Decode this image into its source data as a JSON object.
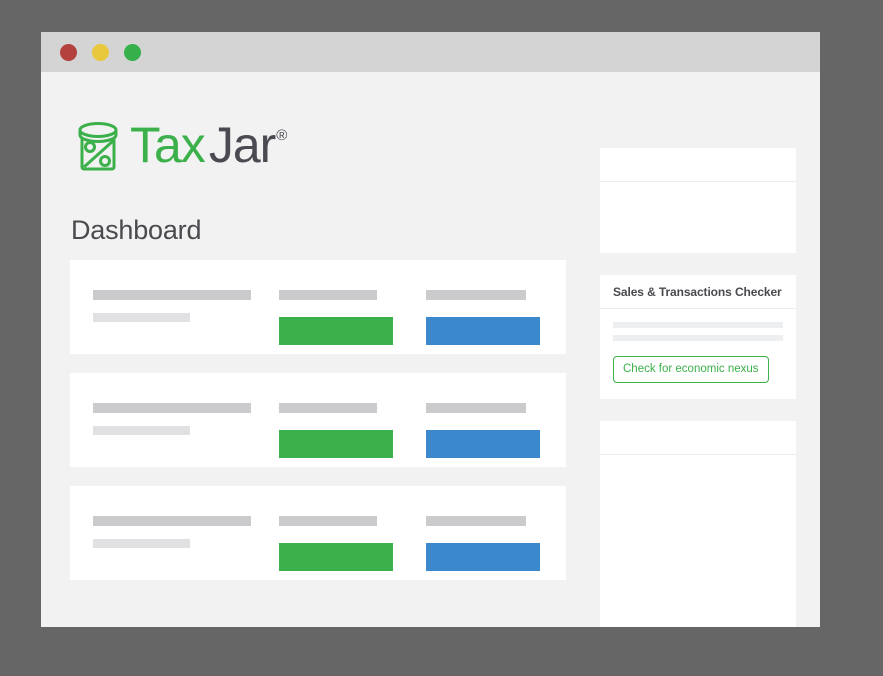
{
  "window": {
    "controls": [
      {
        "name": "close",
        "color": "#b3413e"
      },
      {
        "name": "minimize",
        "color": "#e8c93d"
      },
      {
        "name": "maximize",
        "color": "#36b04a"
      }
    ]
  },
  "brand": {
    "icon": "tax-jar-percent-icon",
    "word_primary": "Tax",
    "word_secondary": "Jar",
    "trademark": "®",
    "color_primary": "#3cb04a",
    "color_secondary": "#4a4a52"
  },
  "page": {
    "title": "Dashboard",
    "background": "#f2f2f2"
  },
  "main": {
    "cards": [
      {
        "title_bar": "",
        "subtitle_bar": "",
        "col_b_label_bar": "",
        "col_c_label_bar": "",
        "action_primary": "",
        "action_secondary": "",
        "action_primary_color": "#3cb04a",
        "action_secondary_color": "#3c88cc"
      },
      {
        "title_bar": "",
        "subtitle_bar": "",
        "col_b_label_bar": "",
        "col_c_label_bar": "",
        "action_primary": "",
        "action_secondary": "",
        "action_primary_color": "#3cb04a",
        "action_secondary_color": "#3c88cc"
      },
      {
        "title_bar": "",
        "subtitle_bar": "",
        "col_b_label_bar": "",
        "col_c_label_bar": "",
        "action_primary": "",
        "action_secondary": "",
        "action_primary_color": "#3cb04a",
        "action_secondary_color": "#3c88cc"
      }
    ]
  },
  "sidebar": {
    "widgets": [
      {
        "title": "",
        "body_text": ""
      },
      {
        "title": "Sales & Transactions Checker",
        "button_label": "Check for economic nexus",
        "button_color": "#3cb04a"
      },
      {
        "title": "",
        "body_text": ""
      }
    ]
  }
}
